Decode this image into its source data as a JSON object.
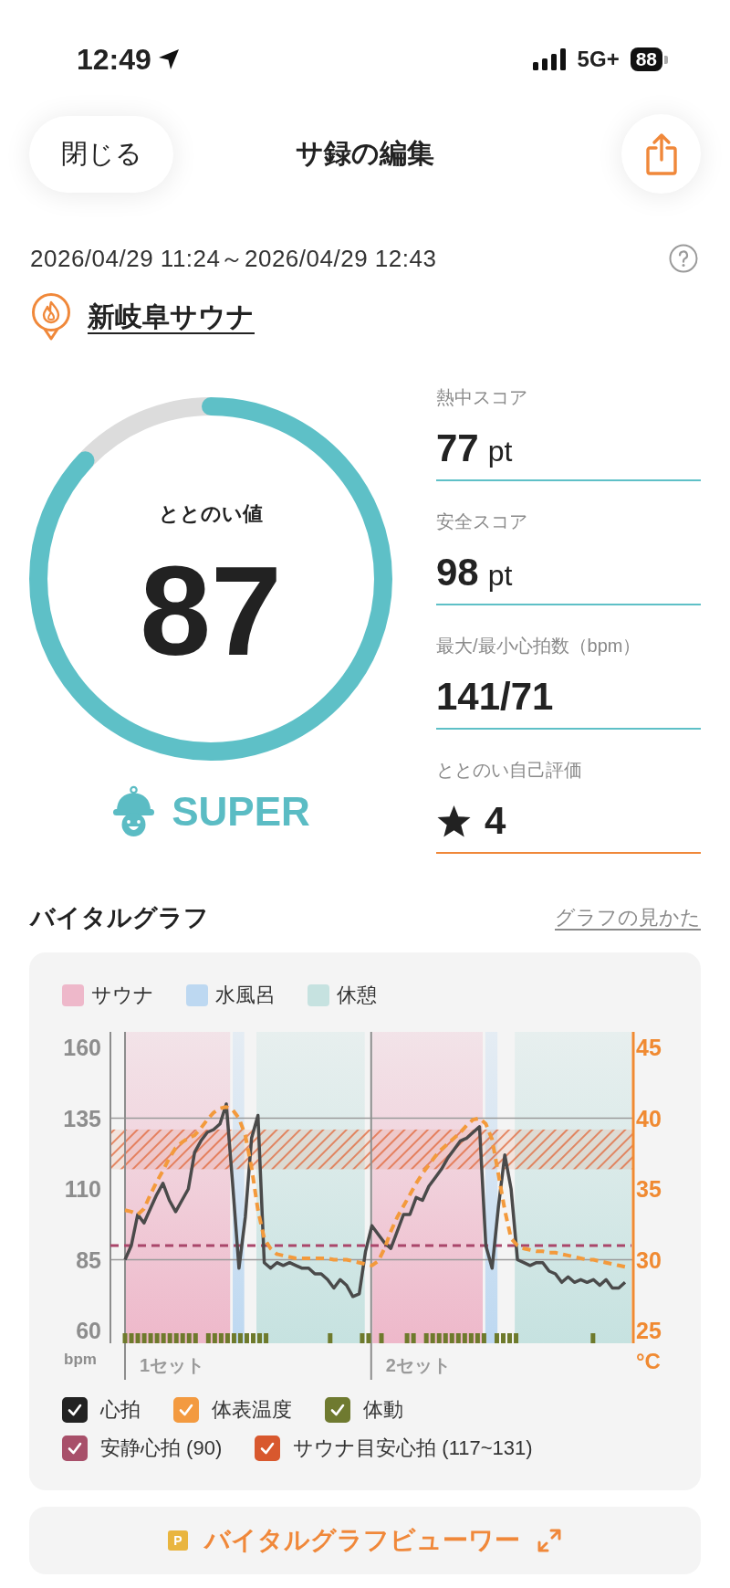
{
  "status_bar": {
    "time": "12:49",
    "network": "5G+",
    "battery": "88"
  },
  "header": {
    "close_button": "閉じる",
    "title": "サ録の編集"
  },
  "session": {
    "period": "2026/04/29 11:24～2026/04/29 12:43",
    "venue": "新岐阜サウナ"
  },
  "score": {
    "label": "ととのい値",
    "value": "87",
    "level": 0.87,
    "rank": "SUPER"
  },
  "metrics": [
    {
      "kind": "number",
      "label": "熱中スコア",
      "value": "77",
      "unit": "pt"
    },
    {
      "kind": "number",
      "label": "安全スコア",
      "value": "98",
      "unit": "pt"
    },
    {
      "kind": "number",
      "label": "最大/最小心拍数（bpm）",
      "value": "141/71"
    },
    {
      "kind": "rating",
      "label": "ととのい自己評価",
      "value": "4"
    }
  ],
  "vital_graph": {
    "title": "バイタルグラフ",
    "help_link": "グラフの見かた",
    "phase_legend": [
      {
        "label": "サウナ",
        "color": "#eeb8ca"
      },
      {
        "label": "水風呂",
        "color": "#bdd8f1"
      },
      {
        "label": "休憩",
        "color": "#c6e2e0"
      }
    ],
    "chart_data": {
      "type": "line",
      "ylabel": "bpm",
      "ylim": [
        55.5,
        165.5
      ],
      "yticks": [
        60,
        85,
        110,
        135,
        160
      ],
      "y2label": "°C",
      "y2lim": [
        24.1,
        46.1
      ],
      "y2ticks": [
        25,
        30,
        35,
        40,
        45
      ],
      "grid": true,
      "series": [
        {
          "color": "#4a4a4a",
          "values": [
            85,
            90,
            101,
            98,
            103,
            108,
            112,
            106,
            102,
            106,
            110,
            123,
            127,
            130,
            131,
            133,
            140,
            112,
            82,
            100,
            128,
            136,
            84,
            82,
            84,
            83,
            84,
            83,
            82,
            82,
            80,
            80,
            78,
            75,
            78,
            76,
            72,
            73,
            88,
            97,
            94,
            91,
            89,
            95,
            101,
            101,
            107,
            106,
            111,
            114,
            117,
            121,
            124,
            127,
            128,
            130,
            132,
            90,
            82,
            104,
            122,
            110,
            85,
            84,
            83,
            84,
            84,
            81,
            80,
            77,
            79,
            77,
            78,
            77,
            78,
            76,
            78,
            75,
            75,
            77
          ]
        },
        {
          "color": "#f39a3c",
          "axis": "y2",
          "line_style": "dashed",
          "values": [
            33.5,
            33.4,
            33.2,
            33.6,
            34.6,
            35.5,
            36.3,
            37.2,
            37.9,
            38.3,
            38.6,
            38.8,
            39.3,
            39.9,
            40.4,
            40.7,
            40.8,
            40.6,
            40.0,
            38.8,
            36.5,
            33.5,
            31.5,
            30.8,
            30.4,
            30.3,
            30.2,
            30.1,
            30.1,
            30.1,
            30.1,
            30.1,
            30.1,
            30.0,
            30.0,
            30.0,
            29.9,
            29.8,
            29.7,
            29.6,
            29.9,
            30.8,
            32.0,
            33.0,
            33.8,
            34.6,
            35.4,
            36.1,
            36.7,
            37.3,
            37.8,
            38.2,
            38.6,
            39.0,
            39.5,
            39.9,
            40.0,
            39.6,
            38.5,
            36.0,
            33.5,
            31.5,
            31.0,
            30.8,
            30.7,
            30.6,
            30.6,
            30.5,
            30.5,
            30.4,
            30.3,
            30.2,
            30.1,
            30.0,
            30.0,
            29.9,
            29.8,
            29.7,
            29.6,
            29.5
          ]
        }
      ],
      "ref_lines": [
        {
          "axis": "y",
          "value": 90,
          "color": "#a9466a"
        }
      ],
      "bands": [
        {
          "axis": "y",
          "from": 117,
          "to": 131,
          "color": "#e2683a"
        }
      ]
    },
    "set_labels": [
      "1セット",
      "2セット"
    ],
    "toggle_rows": [
      [
        {
          "label": "心拍",
          "checked": true,
          "color": "#222222"
        },
        {
          "label": "体表温度",
          "checked": true,
          "color": "#f39a40"
        },
        {
          "label": "体動",
          "checked": true,
          "color": "#6f7a30"
        }
      ],
      [
        {
          "label": "安静心拍 (90)",
          "checked": true,
          "color": "#a8506a"
        },
        {
          "label": "サウナ目安心拍 (117~131)",
          "checked": true,
          "color": "#d8582e"
        }
      ]
    ],
    "viewer_button": {
      "badge": "P",
      "label": "バイタルグラフビューワー"
    }
  }
}
